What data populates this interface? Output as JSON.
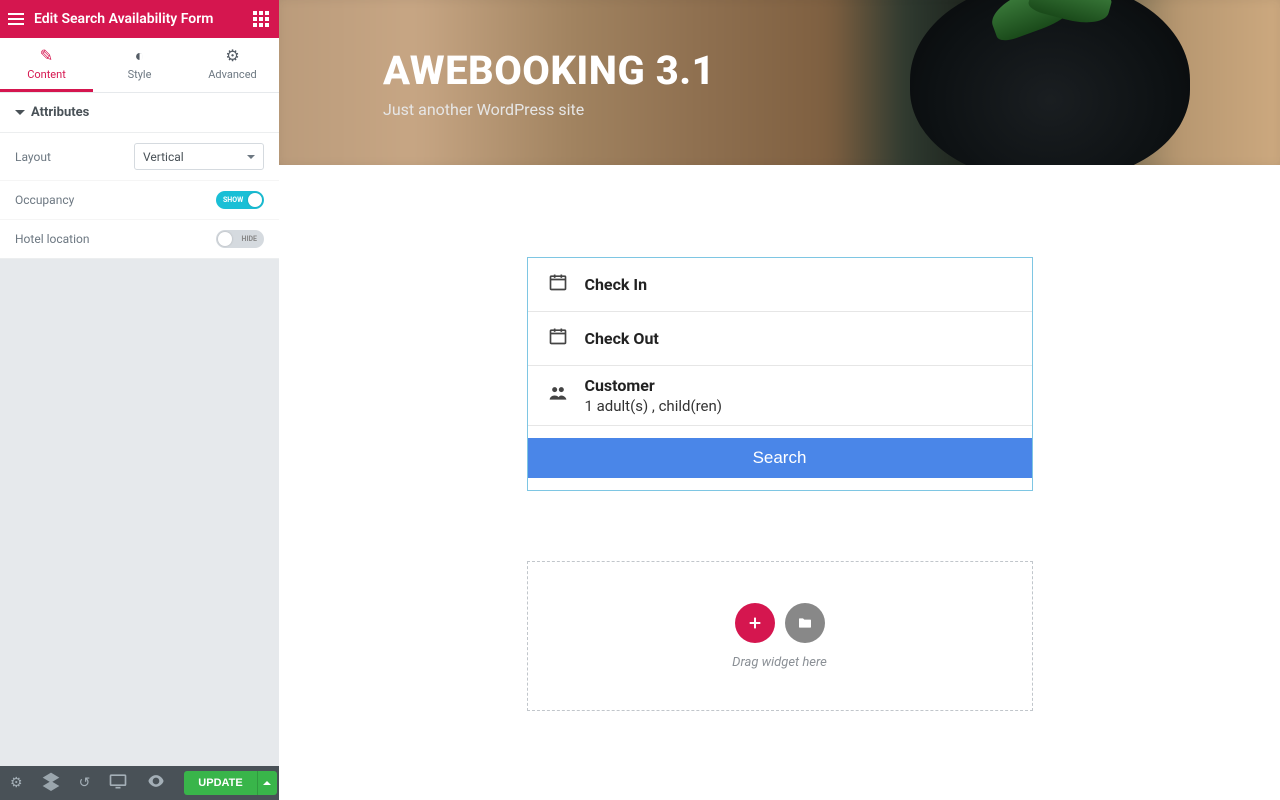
{
  "sidebar": {
    "title": "Edit Search Availability Form",
    "tabs": {
      "content": "Content",
      "style": "Style",
      "advanced": "Advanced"
    },
    "section": {
      "attributes": "Attributes"
    },
    "controls": {
      "layout_label": "Layout",
      "layout_value": "Vertical",
      "occupancy_label": "Occupancy",
      "occupancy_toggle": "SHOW",
      "hotel_location_label": "Hotel location",
      "hotel_location_toggle": "HIDE"
    },
    "footer": {
      "update": "UPDATE"
    }
  },
  "preview": {
    "site_title": "AWEBOOKING 3.1",
    "tagline": "Just another WordPress site",
    "form": {
      "checkin": "Check In",
      "checkout": "Check Out",
      "customer": "Customer",
      "customer_detail": "1 adult(s) , child(ren)",
      "search_btn": "Search"
    },
    "dropzone": "Drag widget here"
  }
}
